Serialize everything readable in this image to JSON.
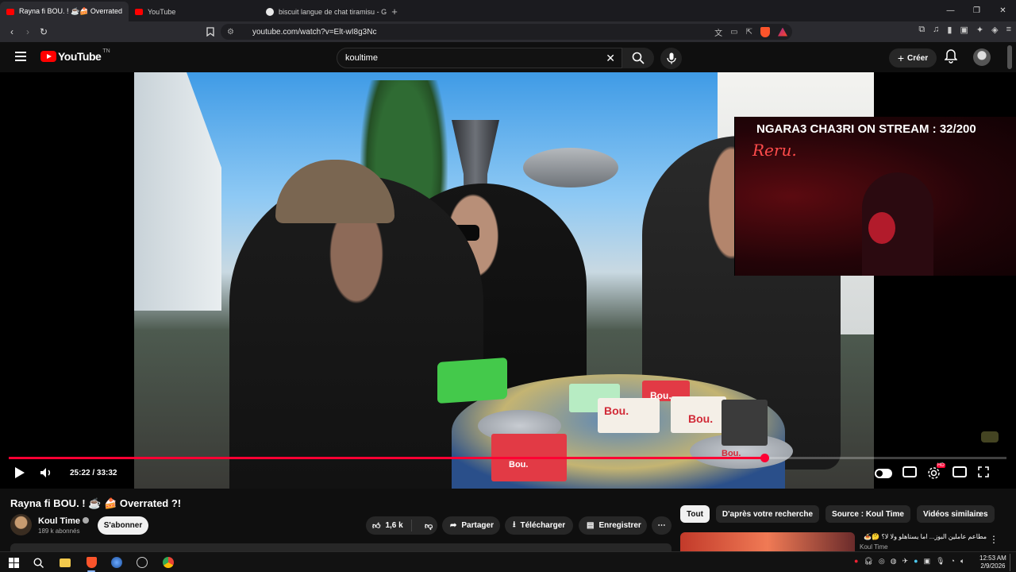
{
  "browser": {
    "tabs": [
      {
        "label": "Rayna fi BOU. ! ☕🍰 Overrated",
        "favicon_color": "#ff0000",
        "active": true
      },
      {
        "label": "YouTube",
        "favicon_color": "#ff0000",
        "active": false
      },
      {
        "label": "biscuit langue de chat tiramisu - Goo",
        "favicon_color": "#e8e8e8",
        "active": false
      }
    ],
    "new_tab": "+",
    "url": "youtube.com/watch?v=Elt-wI8g3Nc",
    "window_controls": {
      "minimize": "—",
      "restore": "❐",
      "close": "✕"
    },
    "shield_badge": "1"
  },
  "youtube": {
    "logo_text": "YouTube",
    "region": "TN",
    "search_value": "koultime",
    "create_label": "Créer",
    "player": {
      "stream_overlay_title": "NGARA3 CHA3RI ON STREAM : 32/200",
      "stream_overlay_signature": "Reru.",
      "time_display": "25:22 / 33:32",
      "progress_fraction": 0.757,
      "hd_badge": "HD",
      "box_labels": [
        "Bou.",
        "Bou.",
        "Bou.",
        "Bou.",
        "Bou."
      ]
    },
    "video": {
      "title": "Rayna fi BOU. ! ☕ 🍰 Overrated ?!",
      "channel_name": "Koul Time",
      "subscribers": "189 k abonnés",
      "subscribe_label": "S'abonner",
      "likes": "1,6 k",
      "share_label": "Partager",
      "download_label": "Télécharger",
      "save_label": "Enregistrer",
      "more_label": "⋯"
    },
    "chips": [
      "Tout",
      "D'après votre recherche",
      "Source : Koul Time",
      "Vidéos similaires"
    ],
    "recommendation": {
      "title": "مطاعم عاملين البوز... اما يستاهلو ولا لا؟ 🤔🍝",
      "channel": "Koul Time"
    }
  },
  "taskbar": {
    "time": "12:53 AM",
    "date": "2/9/2026"
  },
  "colors": {
    "accent_red": "#ff0033",
    "youtube_red": "#ff0000",
    "background": "#0f0f0f"
  }
}
